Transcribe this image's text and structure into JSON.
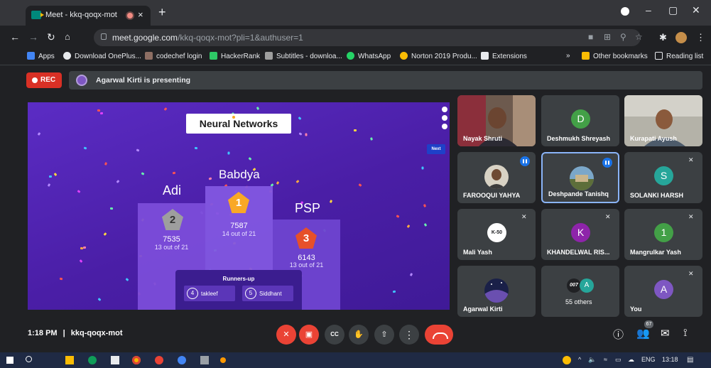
{
  "browser": {
    "tab_title": "Meet - kkq-qoqx-mot",
    "tab_close": "×",
    "new_tab": "+",
    "window_controls": {
      "minimize": "–",
      "maximize": "▢",
      "close": "✕"
    },
    "url_host": "meet.google.com",
    "url_rest": "/kkq-qoqx-mot?pli=1&authuser=1",
    "bookmarks": [
      {
        "label": "Apps",
        "color": "#4285f4"
      },
      {
        "label": "Download OnePlus...",
        "color": "#e8eaed"
      },
      {
        "label": "codechef login",
        "color": "#8d6e63"
      },
      {
        "label": "HackerRank",
        "color": "#2ec866"
      },
      {
        "label": "Subtitles - downloa...",
        "color": "#9e9e9e"
      },
      {
        "label": "WhatsApp",
        "color": "#25d366"
      },
      {
        "label": "Norton 2019 Produ...",
        "color": "#fbbc04"
      },
      {
        "label": "Extensions",
        "color": "#e8eaed"
      }
    ],
    "bookmarks_overflow": "»",
    "other_bookmarks": "Other bookmarks",
    "reading_list": "Reading list"
  },
  "meet": {
    "rec_label": "REC",
    "presenting_text": "Agarwal Kirti is presenting",
    "time": "1:18 PM",
    "separator": "|",
    "meeting_code": "kkq-qoqx-mot",
    "people_count": "67",
    "accent": "#1a73e8",
    "end_call_color": "#ea4335"
  },
  "presentation": {
    "title": "Neural Networks",
    "next_label": "Next",
    "podium": [
      {
        "place": "1",
        "name": "Babdya",
        "score": "7587",
        "detail": "14 out of 21"
      },
      {
        "place": "2",
        "name": "Adi",
        "score": "7535",
        "detail": "13 out of 21"
      },
      {
        "place": "3",
        "name": "PSP",
        "score": "6143",
        "detail": "13 out of 21"
      }
    ],
    "runners_up_title": "Runners-up",
    "runners_up": [
      {
        "place": "4",
        "name": "takleef"
      },
      {
        "place": "5",
        "name": "Siddhant"
      }
    ]
  },
  "participants": [
    {
      "name": "Nayak Shruti",
      "type": "video"
    },
    {
      "name": "Deshmukh Shreyash",
      "type": "avatar",
      "initial": "D",
      "color": "#43a047"
    },
    {
      "name": "Kurapati Ayush",
      "type": "video"
    },
    {
      "name": "FAROOQUI YAHYA",
      "type": "photo",
      "speaking": true
    },
    {
      "name": "Deshpande Tanishq",
      "type": "photo",
      "speaking": true,
      "active": true
    },
    {
      "name": "SOLANKI HARSH",
      "type": "avatar",
      "initial": "S",
      "color": "#26a69a",
      "muted": true
    },
    {
      "name": "Mali Yash",
      "type": "avatar",
      "initial": "K-50",
      "color": "#ffffff",
      "muted": true
    },
    {
      "name": "KHANDELWAL RIS...",
      "type": "avatar",
      "initial": "K",
      "color": "#8e24aa",
      "muted": true
    },
    {
      "name": "Mangrulkar Yash",
      "type": "avatar",
      "initial": "1",
      "color": "#43a047",
      "muted": true
    },
    {
      "name": "Agarwal Kirti",
      "type": "photo"
    },
    {
      "name": "55 others",
      "type": "others",
      "badge_left": "007",
      "badge_right": "A"
    },
    {
      "name": "You",
      "type": "avatar",
      "initial": "A",
      "color": "#7e57c2",
      "muted": true
    }
  ],
  "taskbar": {
    "language": "ENG",
    "clock": "13:18"
  }
}
